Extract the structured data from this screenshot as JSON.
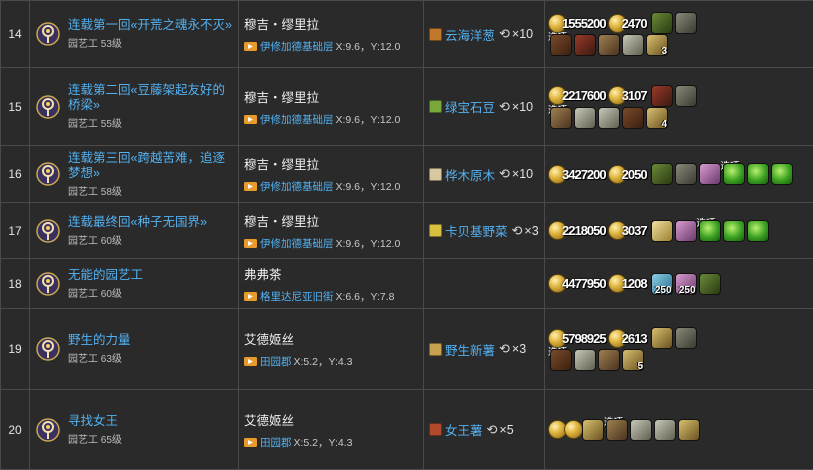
{
  "rows": [
    {
      "num": "14",
      "title": "连载第一回«开荒之魂永不灭»",
      "sub": "园艺工 53级",
      "npc": "穆吉・缪里拉",
      "loc": "伊修加德基础层",
      "coord": "X:9.6，Y:12.0",
      "item": "云海洋葱",
      "qty": "×10",
      "item_color": "#c0782a",
      "l1": [
        {
          "v": "1555200"
        },
        {
          "v": "2470"
        },
        {
          "i": "c4"
        },
        {
          "i": "c1"
        }
      ],
      "l2": [
        {
          "opt": "选项"
        },
        {
          "i": "c0"
        },
        {
          "i": "c8"
        },
        {
          "i": "c2"
        },
        {
          "i": "c9"
        },
        {
          "i": "c3",
          "n": "3"
        }
      ]
    },
    {
      "num": "15",
      "title": "连载第二回«豆藤架起友好的桥梁»",
      "sub": "园艺工 55级",
      "npc": "穆吉・缪里拉",
      "loc": "伊修加德基础层",
      "coord": "X:9.6，Y:12.0",
      "item": "绿宝石豆",
      "qty": "×10",
      "item_color": "#7aa83a",
      "l1": [
        {
          "v": "2217600"
        },
        {
          "v": "3107"
        },
        {
          "i": "c8"
        },
        {
          "i": "c1"
        }
      ],
      "l2": [
        {
          "opt": "选项"
        },
        {
          "i": "c2"
        },
        {
          "i": "c9"
        },
        {
          "i": "c9"
        },
        {
          "i": "c0"
        },
        {
          "i": "c3",
          "n": "4"
        }
      ]
    },
    {
      "num": "16",
      "title": "连载第三回«跨越苦难，追逐梦想»",
      "sub": "园艺工 58级",
      "npc": "穆吉・缪里拉",
      "loc": "伊修加德基础层",
      "coord": "X:9.6，Y:12.0",
      "item": "桦木原木",
      "qty": "×10",
      "item_color": "#d8c8a0",
      "l1": [
        {
          "v": "3427200"
        },
        {
          "v": "2050"
        },
        {
          "i": "c4"
        },
        {
          "i": "c1"
        },
        {
          "i": "c6"
        },
        {
          "opt": "选项"
        },
        {
          "i": "cg"
        },
        {
          "i": "cg"
        },
        {
          "i": "cg"
        }
      ],
      "l2": []
    },
    {
      "num": "17",
      "title": "连载最终回«种子无国界»",
      "sub": "园艺工 60级",
      "npc": "穆吉・缪里拉",
      "loc": "伊修加德基础层",
      "coord": "X:9.6，Y:12.0",
      "item": "卡贝基野菜",
      "qty": "×3",
      "item_color": "#d8c040",
      "l1": [
        {
          "v": "2218050"
        },
        {
          "v": "3037"
        },
        {
          "i": "cy"
        },
        {
          "i": "c6"
        },
        {
          "opt": "选项"
        },
        {
          "i": "cg"
        },
        {
          "i": "cg"
        },
        {
          "i": "cg"
        }
      ],
      "l2": []
    },
    {
      "num": "18",
      "title": "无能的园艺工",
      "sub": "园艺工 60级",
      "npc": "弗弗茶",
      "loc": "格里达尼亚旧街",
      "coord": "X:6.6，Y:7.8",
      "item": "",
      "qty": "",
      "item_color": "",
      "l1": [
        {
          "v": "4477950"
        },
        {
          "v": "1208"
        },
        {
          "i": "c7",
          "n": "250"
        },
        {
          "i": "c6",
          "n": "250"
        },
        {
          "i": "c4"
        }
      ],
      "l2": []
    },
    {
      "num": "19",
      "title": "野生的力量",
      "sub": "园艺工 63级",
      "npc": "艾德姬丝",
      "loc": "田园郡",
      "coord": "X:5.2，Y:4.3",
      "item": "野生新薯",
      "qty": "×3",
      "item_color": "#c8a050",
      "l1": [
        {
          "v": "5798925"
        },
        {
          "v": "2613"
        },
        {
          "i": "c3"
        },
        {
          "i": "c1"
        }
      ],
      "l2": [
        {
          "opt": "选项"
        },
        {
          "i": "c0"
        },
        {
          "i": "c9"
        },
        {
          "i": "c2"
        },
        {
          "i": "c3",
          "n": "5"
        }
      ]
    },
    {
      "num": "20",
      "title": "寻找女王",
      "sub": "园艺工 65级",
      "npc": "艾德姬丝",
      "loc": "田园郡",
      "coord": "X:5.2，Y:4.3",
      "item": "女王薯",
      "qty": "×5",
      "item_color": "#b04a2a",
      "l1": [
        {
          "v": ""
        },
        {
          "v": ""
        },
        {
          "i": "c3"
        },
        {
          "opt": "选项"
        },
        {
          "i": "c2"
        },
        {
          "i": "c9"
        },
        {
          "i": "c9"
        },
        {
          "i": "c3"
        }
      ],
      "l2": []
    }
  ]
}
